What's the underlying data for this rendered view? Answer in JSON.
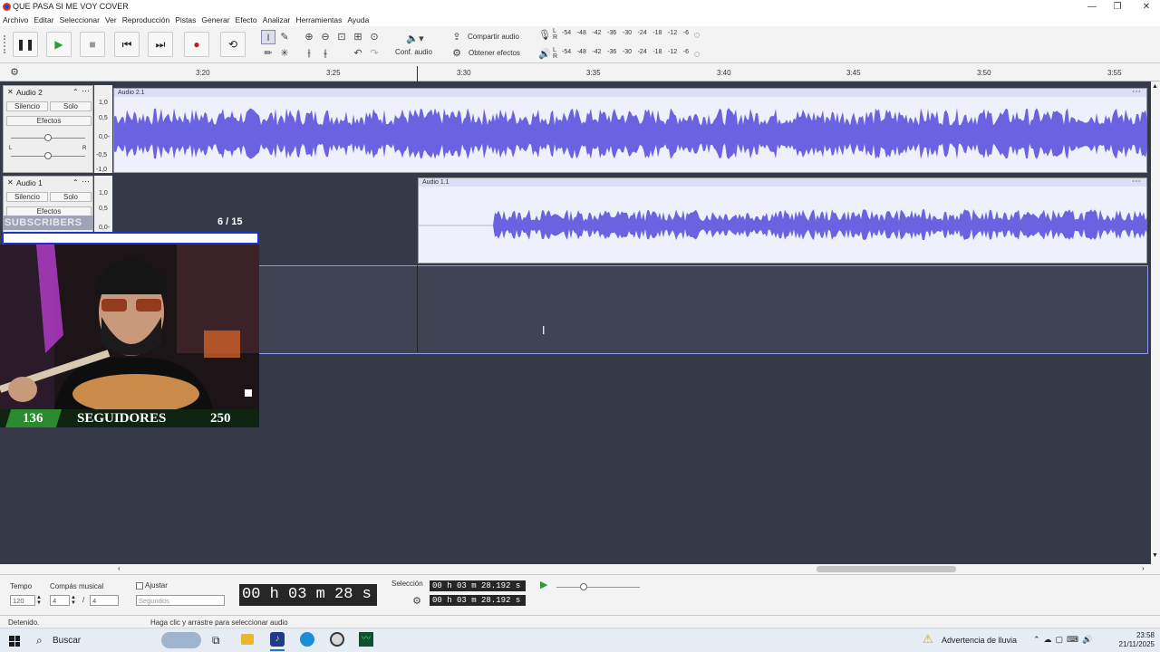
{
  "window": {
    "title": "QUE PASA SI ME VOY COVER",
    "minimize": "—",
    "maximize": "❐",
    "close": "✕"
  },
  "menu": [
    "Archivo",
    "Editar",
    "Seleccionar",
    "Ver",
    "Reproducción",
    "Pistas",
    "Generar",
    "Efecto",
    "Analizar",
    "Herramientas",
    "Ayuda"
  ],
  "toolbar": {
    "audio_setup": "Conf. audio",
    "share_audio": "Compartir audio",
    "get_effects": "Obtener efectos",
    "meter_ticks": [
      "-54",
      "-48",
      "-42",
      "-36",
      "-30",
      "-24",
      "-18",
      "-12",
      "-6"
    ],
    "rec_channels": "L\nR",
    "play_channels": "L\nR"
  },
  "timeline": {
    "ticks": [
      "3:20",
      "3:25",
      "3:30",
      "3:35",
      "3:40",
      "3:45",
      "3:50",
      "3:55"
    ]
  },
  "tracks": [
    {
      "name": "Audio 2",
      "mute": "Silencio",
      "solo": "Solo",
      "effects": "Efectos",
      "clip": "Audio 2.1",
      "pan_l": "L",
      "pan_r": "R",
      "scale": [
        "1,0",
        "0,5",
        "0,0-",
        "-0,5",
        "-1,0"
      ]
    },
    {
      "name": "Audio 1",
      "mute": "Silencio",
      "solo": "Solo",
      "effects": "Efectos",
      "clip": "Audio 1.1",
      "scale": [
        "1,0",
        "0,5",
        "0,0-"
      ]
    }
  ],
  "overlay": {
    "subs_label": "SUBSCRIBERS",
    "subs_count": "6 / 15",
    "followers_current": "136",
    "followers_label": "SEGUIDORES",
    "followers_goal": "250"
  },
  "bottom": {
    "tempo_label": "Tempo",
    "tempo_value": "120",
    "meter_label": "Compás musical",
    "meter_num": "4",
    "meter_sep": "/",
    "meter_den": "4",
    "snap_label": "Ajustar",
    "snap_unit": "Segundos",
    "time_display": "00 h 03 m 28 s",
    "selection_label": "Selección",
    "sel_start": "00 h 03 m 28.192 s",
    "sel_end": "00 h 03 m 28.192 s"
  },
  "status": {
    "left": "Detenido.",
    "hint": "Haga clic y arrastre para seleccionar audio"
  },
  "taskbar": {
    "search": "Buscar",
    "weather": "Advertencia de lluvia",
    "time": "23:58",
    "date": "21/11/2025"
  }
}
